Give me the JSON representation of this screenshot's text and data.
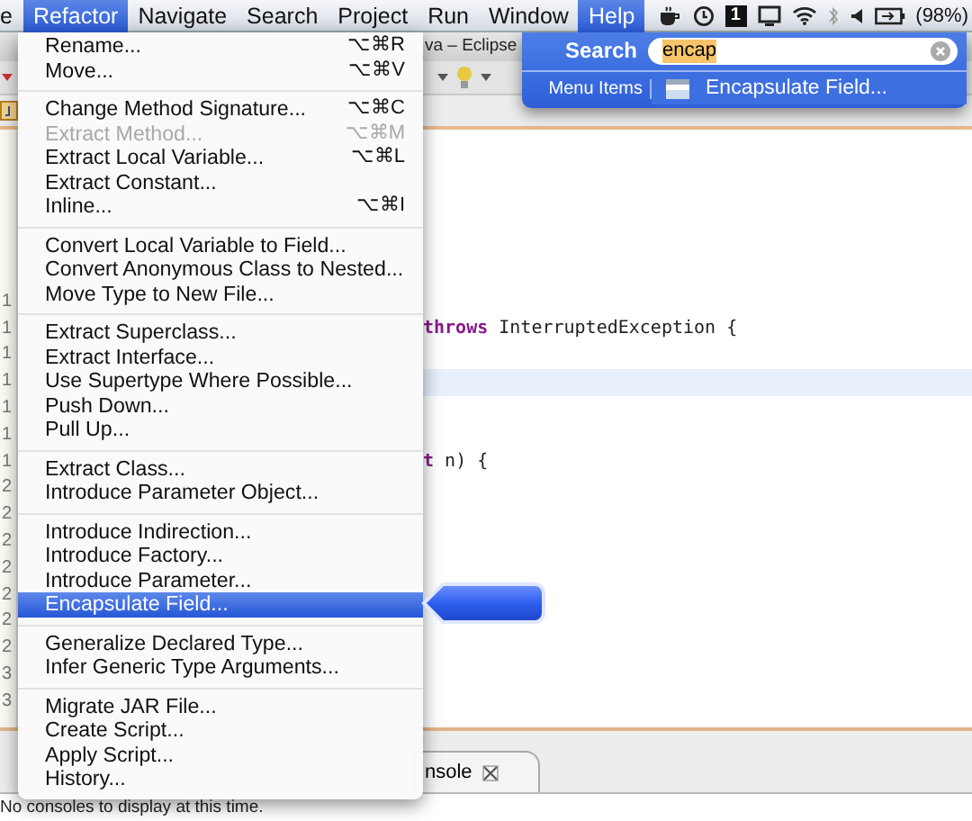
{
  "menubar": {
    "items": [
      {
        "label": "e",
        "selected": false
      },
      {
        "label": "Refactor",
        "selected": true
      },
      {
        "label": "Navigate",
        "selected": false
      },
      {
        "label": "Search",
        "selected": false
      },
      {
        "label": "Project",
        "selected": false
      },
      {
        "label": "Run",
        "selected": false
      },
      {
        "label": "Window",
        "selected": false
      },
      {
        "label": "Help",
        "selected": true
      }
    ],
    "spaces_number": "1",
    "battery": "(98%)"
  },
  "window": {
    "title": "va – Eclipse"
  },
  "editor": {
    "gutter": [
      "1",
      "1",
      "1",
      "1",
      "1",
      "1",
      "1",
      "2",
      "2",
      "2",
      "2",
      "2",
      "2",
      "2",
      "3",
      "3"
    ],
    "lines": [
      {
        "current": false,
        "tokens": [
          {
            "kind": "keyword",
            "text": "throws"
          },
          {
            "kind": "plain",
            "text": " InterruptedException {"
          }
        ]
      },
      {
        "current": true
      },
      {
        "current": false,
        "tokens": [
          {
            "kind": "keyword",
            "text": "t"
          },
          {
            "kind": "plain",
            "text": " n) {"
          }
        ]
      }
    ]
  },
  "console": {
    "tab": "nsole",
    "message": "No consoles to display at this time."
  },
  "refactor_menu": {
    "groups": [
      [
        {
          "label": "Rename...",
          "shortcut": "⌥⌘R",
          "disabled": false,
          "selected": false
        },
        {
          "label": "Move...",
          "shortcut": "⌥⌘V",
          "disabled": false,
          "selected": false
        }
      ],
      [
        {
          "label": "Change Method Signature...",
          "shortcut": "⌥⌘C",
          "disabled": false,
          "selected": false
        },
        {
          "label": "Extract Method...",
          "shortcut": "⌥⌘M",
          "disabled": true,
          "selected": false
        },
        {
          "label": "Extract Local Variable...",
          "shortcut": "⌥⌘L",
          "disabled": false,
          "selected": false
        },
        {
          "label": "Extract Constant...",
          "disabled": false,
          "selected": false
        },
        {
          "label": "Inline...",
          "shortcut": "⌥⌘I",
          "disabled": false,
          "selected": false
        }
      ],
      [
        {
          "label": "Convert Local Variable to Field...",
          "disabled": false,
          "selected": false
        },
        {
          "label": "Convert Anonymous Class to Nested...",
          "disabled": false,
          "selected": false
        },
        {
          "label": "Move Type to New File...",
          "disabled": false,
          "selected": false
        }
      ],
      [
        {
          "label": "Extract Superclass...",
          "disabled": false,
          "selected": false
        },
        {
          "label": "Extract Interface...",
          "disabled": false,
          "selected": false
        },
        {
          "label": "Use Supertype Where Possible...",
          "disabled": false,
          "selected": false
        },
        {
          "label": "Push Down...",
          "disabled": false,
          "selected": false
        },
        {
          "label": "Pull Up...",
          "disabled": false,
          "selected": false
        }
      ],
      [
        {
          "label": "Extract Class...",
          "disabled": false,
          "selected": false
        },
        {
          "label": "Introduce Parameter Object...",
          "disabled": false,
          "selected": false
        }
      ],
      [
        {
          "label": "Introduce Indirection...",
          "disabled": false,
          "selected": false
        },
        {
          "label": "Introduce Factory...",
          "disabled": false,
          "selected": false
        },
        {
          "label": "Introduce Parameter...",
          "disabled": false,
          "selected": false
        },
        {
          "label": "Encapsulate Field...",
          "disabled": false,
          "selected": true
        }
      ],
      [
        {
          "label": "Generalize Declared Type...",
          "disabled": false,
          "selected": false
        },
        {
          "label": "Infer Generic Type Arguments...",
          "disabled": false,
          "selected": false
        }
      ],
      [
        {
          "label": "Migrate JAR File...",
          "disabled": false,
          "selected": false
        },
        {
          "label": "Create Script...",
          "disabled": false,
          "selected": false
        },
        {
          "label": "Apply Script...",
          "disabled": false,
          "selected": false
        },
        {
          "label": "History...",
          "disabled": false,
          "selected": false
        }
      ]
    ]
  },
  "help_menu": {
    "search_label": "Search",
    "search_value": "encap",
    "section": "Menu Items",
    "results": [
      {
        "label": "Encapsulate Field...",
        "selected": true
      }
    ]
  }
}
